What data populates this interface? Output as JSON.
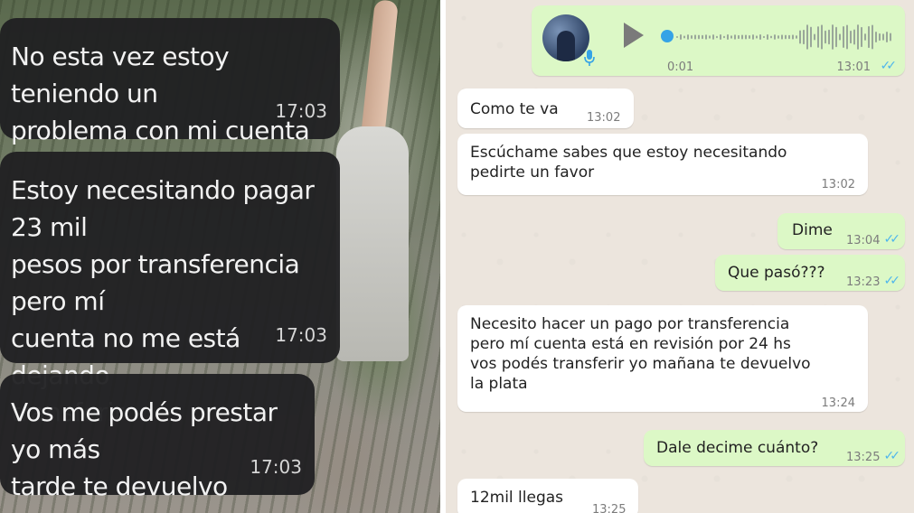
{
  "left_chat": {
    "messages": [
      {
        "text": "No esta vez estoy teniendo un\nproblema con mi cuenta",
        "time": "17:03"
      },
      {
        "text": "Estoy necesitando pagar 23 mil\npesos por transferencia pero mí\ncuenta no me está dejando\ntransferir",
        "time": "17:03"
      },
      {
        "text": "Vos me podés prestar yo más\ntarde te devuelvo",
        "time": "17:03"
      }
    ]
  },
  "right_chat": {
    "voice_message": {
      "duration": "0:01",
      "time": "13:01",
      "ticks": "✓✓",
      "icons": {
        "play": "play-icon",
        "mic": "mic-icon",
        "avatar": "avatar"
      }
    },
    "messages": [
      {
        "direction": "in",
        "text": "Como te va",
        "time": "13:02"
      },
      {
        "direction": "in",
        "text": "Escúchame sabes que estoy necesitando\npedirte un favor",
        "time": "13:02"
      },
      {
        "direction": "out",
        "text": "Dime",
        "time": "13:04",
        "ticks": "✓✓"
      },
      {
        "direction": "out",
        "text": "Que pasó???",
        "time": "13:23",
        "ticks": "✓✓"
      },
      {
        "direction": "in",
        "text": "Necesito hacer un pago por transferencia\npero mí cuenta está en revisión por 24 hs\nvos podés transferir yo mañana te devuelvo\nla plata",
        "time": "13:24"
      },
      {
        "direction": "out",
        "text": "Dale decime cuánto?",
        "time": "13:25",
        "ticks": "✓✓"
      },
      {
        "direction": "in",
        "text": "12mil llegas",
        "time": "13:25"
      }
    ]
  },
  "colors": {
    "dark_bubble": "#202022",
    "incoming_bubble": "#ffffff",
    "outgoing_bubble": "#dcf8c6",
    "chat_background": "#ece5dd",
    "read_ticks": "#4fb6ec",
    "voice_knob": "#35a3e6"
  }
}
